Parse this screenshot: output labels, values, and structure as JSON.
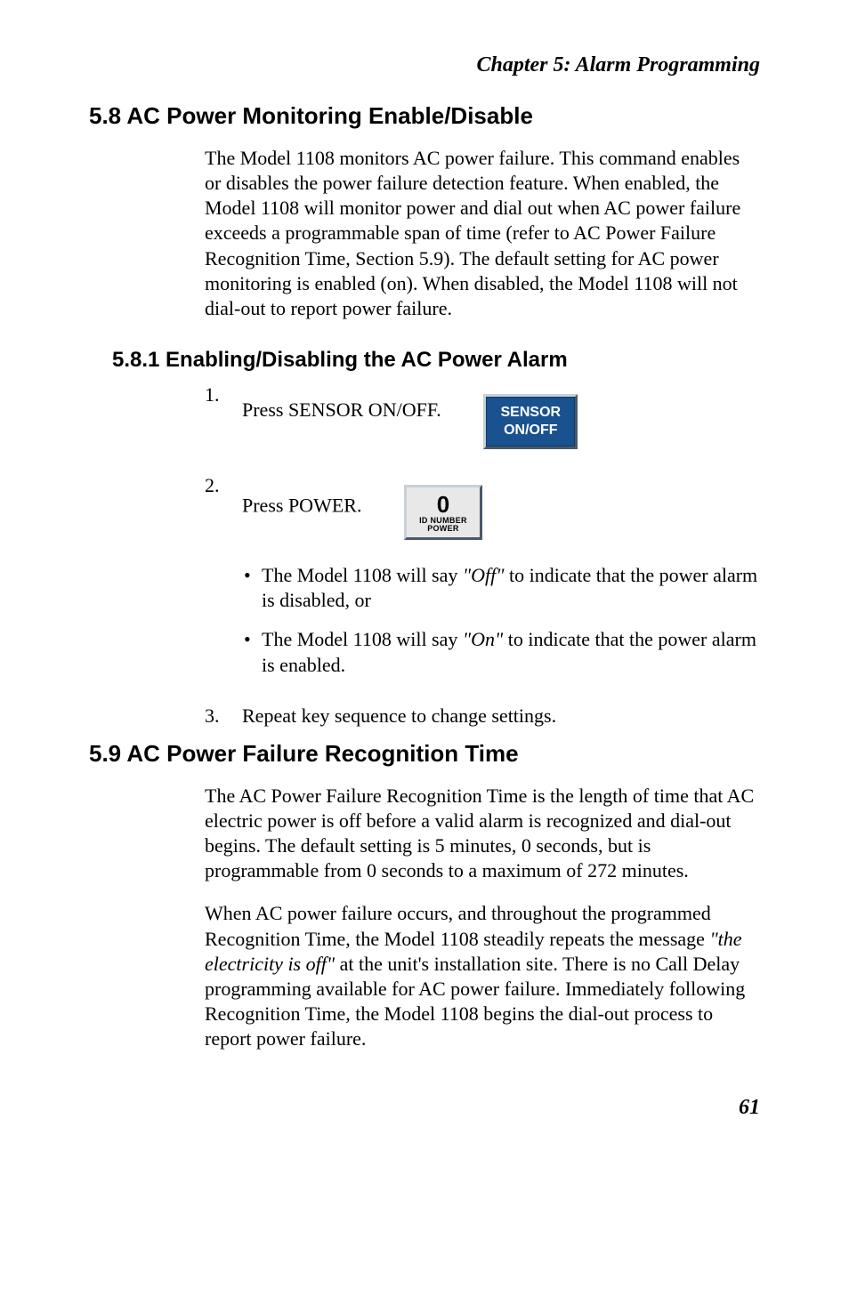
{
  "chapterHeader": "Chapter  5:  Alarm Programming",
  "sec58": {
    "heading": "5.8   AC Power Monitoring Enable/Disable",
    "para": "The Model 1108 monitors AC power failure. This command enables or disables the power failure detection feature. When enabled, the Model 1108 will monitor power and dial out when AC power failure exceeds a programmable span of  time (refer to AC Power Failure Recognition Time, Section 5.9). The default setting for AC power monitoring is enabled (on). When disabled, the Model 1108 will not dial-out to report power failure."
  },
  "sec581": {
    "heading": "5.8.1  Enabling/Disabling the AC Power Alarm",
    "step1": {
      "num": "1.",
      "text": "Press SENSOR ON/OFF."
    },
    "sensorKey": {
      "line1": "SENSOR",
      "line2": "ON/OFF"
    },
    "step2": {
      "num": "2.",
      "text": "Press POWER."
    },
    "powerKey": {
      "big": "0",
      "sub1": "ID NUMBER",
      "sub2": "POWER"
    },
    "bullet1": {
      "pre": "The Model 1108 will say ",
      "ital": "\"Off\"",
      "post": " to indicate that the power alarm is disabled, or"
    },
    "bullet2": {
      "pre": "The Model 1108 will say ",
      "ital": "\"On\"",
      "post": " to indicate that the power alarm is enabled."
    },
    "step3": {
      "num": "3.",
      "text": "Repeat key sequence to change settings."
    }
  },
  "sec59": {
    "heading": "5.9   AC Power Failure Recognition Time",
    "para1": "The AC Power Failure Recognition Time is the length of time that AC electric power is off before a valid alarm is recognized and dial-out begins. The default setting is 5 minutes, 0 seconds, but is programmable from 0 seconds to a maximum of 272 minutes.",
    "para2pre": "When AC power failure occurs, and throughout the programmed Recognition Time, the Model 1108 steadily repeats the message ",
    "para2ital": "\"the electricity is off\"",
    "para2post": " at the unit's installation site. There is no Call Delay programming available for AC power failure. Immediately following Recognition Time, the Model 1108 begins the dial-out process to report power failure."
  },
  "pageNumber": "61"
}
